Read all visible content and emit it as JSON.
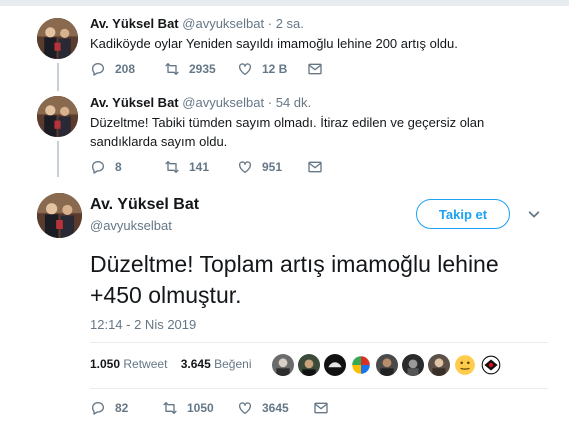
{
  "tweets": [
    {
      "name": "Av. Yüksel Bat",
      "handle": "@avyukselbat",
      "dot": "·",
      "time": "2 sa.",
      "text": "Kadiköyde oylar Yeniden sayıldı imamoğlu lehine 200 artış oldu.",
      "replies": "208",
      "retweets": "2935",
      "likes": "12 B"
    },
    {
      "name": "Av. Yüksel Bat",
      "handle": "@avyukselbat",
      "dot": "·",
      "time": "54 dk.",
      "text": "Düzeltme! Tabiki tümden sayım olmadı. İtiraz edilen ve geçersiz olan sandıklarda sayım oldu.",
      "replies": "8",
      "retweets": "141",
      "likes": "951"
    }
  ],
  "main": {
    "name": "Av. Yüksel Bat",
    "handle": "@avyukselbat",
    "follow_label": "Takip et",
    "text": "Düzeltme! Toplam artış imamoğlu lehine +450 olmuştur.",
    "timestamp": "12:14 - 2 Nis 2019",
    "retweet_count": "1.050",
    "retweet_label": "Retweet",
    "like_count": "3.645",
    "like_label": "Beğeni",
    "replies": "82",
    "retweets": "1050",
    "likes": "3645"
  },
  "icons": {
    "reply": "reply-icon",
    "retweet": "retweet-icon",
    "like": "heart-icon",
    "dm": "envelope-icon",
    "caret": "chevron-down-icon"
  },
  "colors": {
    "accent": "#1da1f2",
    "muted": "#657786",
    "text": "#14171a"
  }
}
